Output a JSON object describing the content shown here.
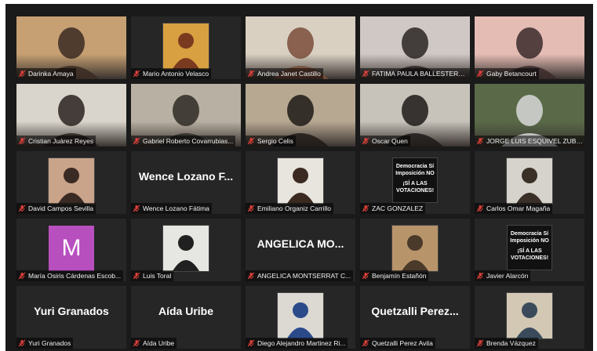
{
  "participants": [
    {
      "name": "Darinka Amaya",
      "type": "video",
      "bg": "#c6a072",
      "fg": "#3a2a22"
    },
    {
      "name": "Mario Antonio Velasco",
      "type": "image",
      "bg": "#d8a040",
      "fg": "#7a3a20"
    },
    {
      "name": "Andrea Janet Castillo",
      "type": "video",
      "bg": "#d9d0c2",
      "fg": "#7a4d3a"
    },
    {
      "name": "FATIMA PAULA BALLESTERO...",
      "type": "video",
      "bg": "#cfc8c4",
      "fg": "#2a2424"
    },
    {
      "name": "Gaby Betancourt",
      "type": "video",
      "bg": "#e4bcb4",
      "fg": "#3a2a2a"
    },
    {
      "name": "Cristian Juárez Reyes",
      "type": "video",
      "bg": "#d9d4cc",
      "fg": "#2a2220"
    },
    {
      "name": "Gabriel Roberto Covarrubias...",
      "type": "video",
      "bg": "#b8b0a2",
      "fg": "#2e2a26"
    },
    {
      "name": "Sergio Celis",
      "type": "video",
      "bg": "#b7a892",
      "fg": "#1e1a16"
    },
    {
      "name": "Oscar Quen",
      "type": "video",
      "bg": "#c7c2ba",
      "fg": "#1c1a18"
    },
    {
      "name": "JORGE LUIS ESQUIVEL ZUBIRI",
      "type": "video",
      "bg": "#5a6a48",
      "fg": "#d8d8d8",
      "active": true
    },
    {
      "name": "David Campos Sevilla",
      "type": "image",
      "bg": "#c9a38a",
      "fg": "#3a2a24"
    },
    {
      "name": "Wence Lozano Fátima",
      "type": "text",
      "display": "Wence Lozano F..."
    },
    {
      "name": "Emiliano Organiz Carrillo",
      "type": "image",
      "bg": "#e8e4de",
      "fg": "#3a2a22"
    },
    {
      "name": "ZAC GONZALEZ",
      "type": "sign",
      "sign": [
        "Democracia Sí",
        "Imposición NO",
        "",
        "¡SÍ A LAS",
        "VOTACIONES!"
      ]
    },
    {
      "name": "Carlos Omar Magaña",
      "type": "image",
      "bg": "#d6d2cc",
      "fg": "#3a3028"
    },
    {
      "name": "María Osiris Cárdenas Escob...",
      "type": "avatar",
      "letter": "M"
    },
    {
      "name": "Luis Toral",
      "type": "image",
      "bg": "#e6e6e2",
      "fg": "#202020"
    },
    {
      "name": "ANGELICA MONTSERRAT C...",
      "type": "text",
      "display": "ANGELICA MO..."
    },
    {
      "name": "Benjamín Estañón",
      "type": "image",
      "bg": "#b8946a",
      "fg": "#4a3a2a"
    },
    {
      "name": "Javier Alarcón",
      "type": "sign",
      "sign": [
        "Democracia Sí",
        "Imposición NO",
        "",
        "¡SÍ A LAS",
        "VOTACIONES!"
      ]
    },
    {
      "name": "Yuri Granados",
      "type": "text",
      "display": "Yuri Granados"
    },
    {
      "name": "Aída Uribe",
      "type": "text",
      "display": "Aída Uribe"
    },
    {
      "name": "Diego Alejandro Martinez Ri...",
      "type": "image",
      "bg": "#dcd8d2",
      "fg": "#2a4a8a"
    },
    {
      "name": "Quetzalli Perez Avila",
      "type": "text",
      "display": "Quetzalli  Perez..."
    },
    {
      "name": "Brenda Vázquez",
      "type": "image",
      "bg": "#d2c8b4",
      "fg": "#3a4a5a"
    }
  ],
  "colors": {
    "muted_icon": "#e0403a",
    "active_border": "#8fd14f",
    "avatar_bg": "#b84fbf"
  }
}
